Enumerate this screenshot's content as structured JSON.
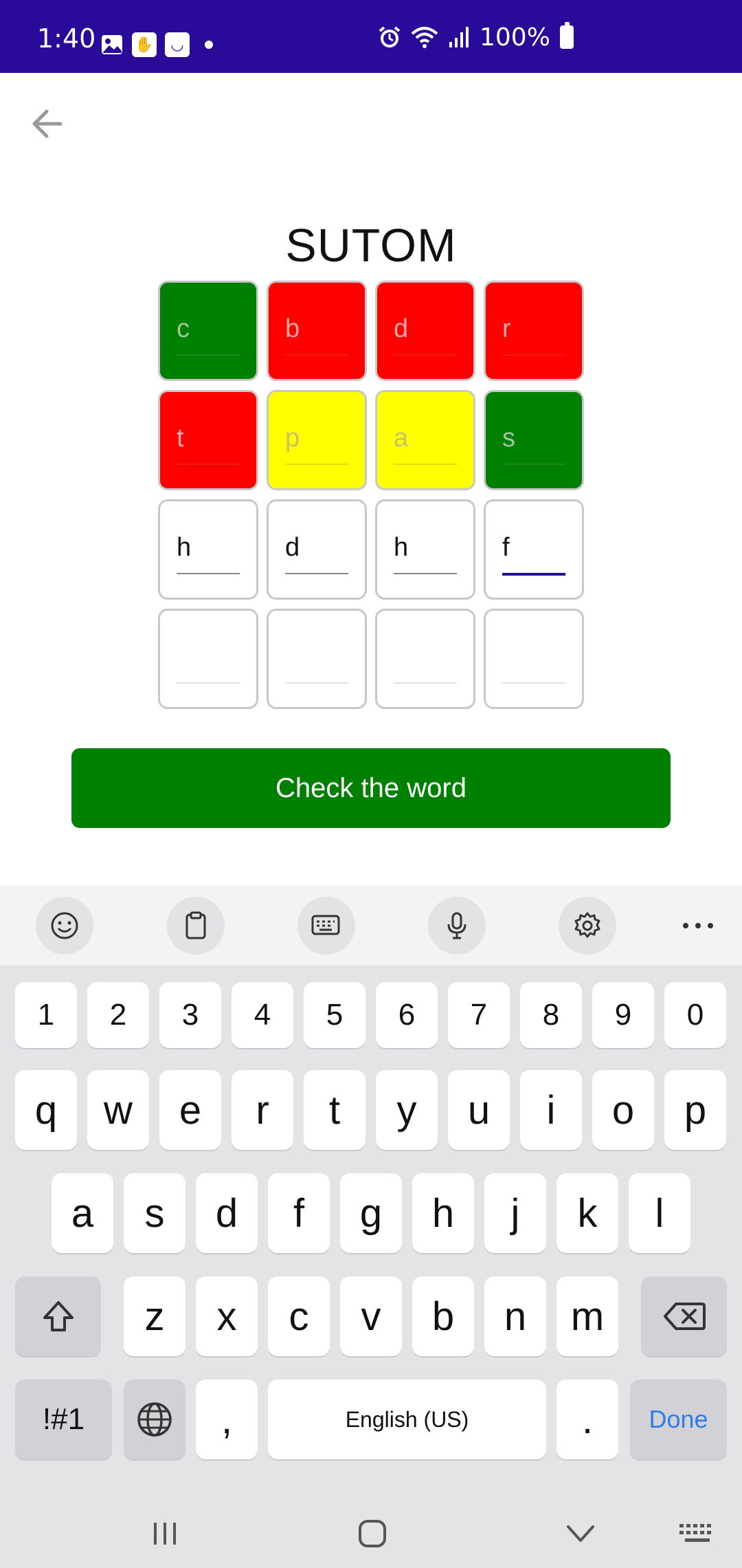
{
  "status_bar": {
    "time": "1:40",
    "battery": "100%",
    "icons_left": [
      "image-icon",
      "hand-icon",
      "smile-icon"
    ],
    "icons_right": [
      "alarm-icon",
      "wifi-icon",
      "signal-icon",
      "battery-icon"
    ]
  },
  "title": "SUTOM",
  "grid": {
    "rows": [
      [
        {
          "letter": "c",
          "state": "green"
        },
        {
          "letter": "b",
          "state": "red"
        },
        {
          "letter": "d",
          "state": "red"
        },
        {
          "letter": "r",
          "state": "red"
        }
      ],
      [
        {
          "letter": "t",
          "state": "red"
        },
        {
          "letter": "p",
          "state": "yellow"
        },
        {
          "letter": "a",
          "state": "yellow"
        },
        {
          "letter": "s",
          "state": "green"
        }
      ],
      [
        {
          "letter": "h",
          "state": "white"
        },
        {
          "letter": "d",
          "state": "white"
        },
        {
          "letter": "h",
          "state": "white"
        },
        {
          "letter": "f",
          "state": "active"
        }
      ],
      [
        {
          "letter": "",
          "state": "empty"
        },
        {
          "letter": "",
          "state": "empty"
        },
        {
          "letter": "",
          "state": "empty"
        },
        {
          "letter": "",
          "state": "empty"
        }
      ]
    ],
    "colors": {
      "green": "#008000",
      "red": "#ff0000",
      "yellow": "#ffff00"
    }
  },
  "check_button": {
    "label": "Check the word"
  },
  "keyboard": {
    "toolbar": [
      "emoji-icon",
      "clipboard-icon",
      "keyboard-icon",
      "microphone-icon",
      "settings-icon",
      "more-icon"
    ],
    "number_row": [
      "1",
      "2",
      "3",
      "4",
      "5",
      "6",
      "7",
      "8",
      "9",
      "0"
    ],
    "row1": [
      "q",
      "w",
      "e",
      "r",
      "t",
      "y",
      "u",
      "i",
      "o",
      "p"
    ],
    "row2": [
      "a",
      "s",
      "d",
      "f",
      "g",
      "h",
      "j",
      "k",
      "l"
    ],
    "row3": [
      "z",
      "x",
      "c",
      "v",
      "b",
      "n",
      "m"
    ],
    "symbols_label": "!#1",
    "comma": ",",
    "space_label": "English (US)",
    "period": ".",
    "done_label": "Done"
  }
}
